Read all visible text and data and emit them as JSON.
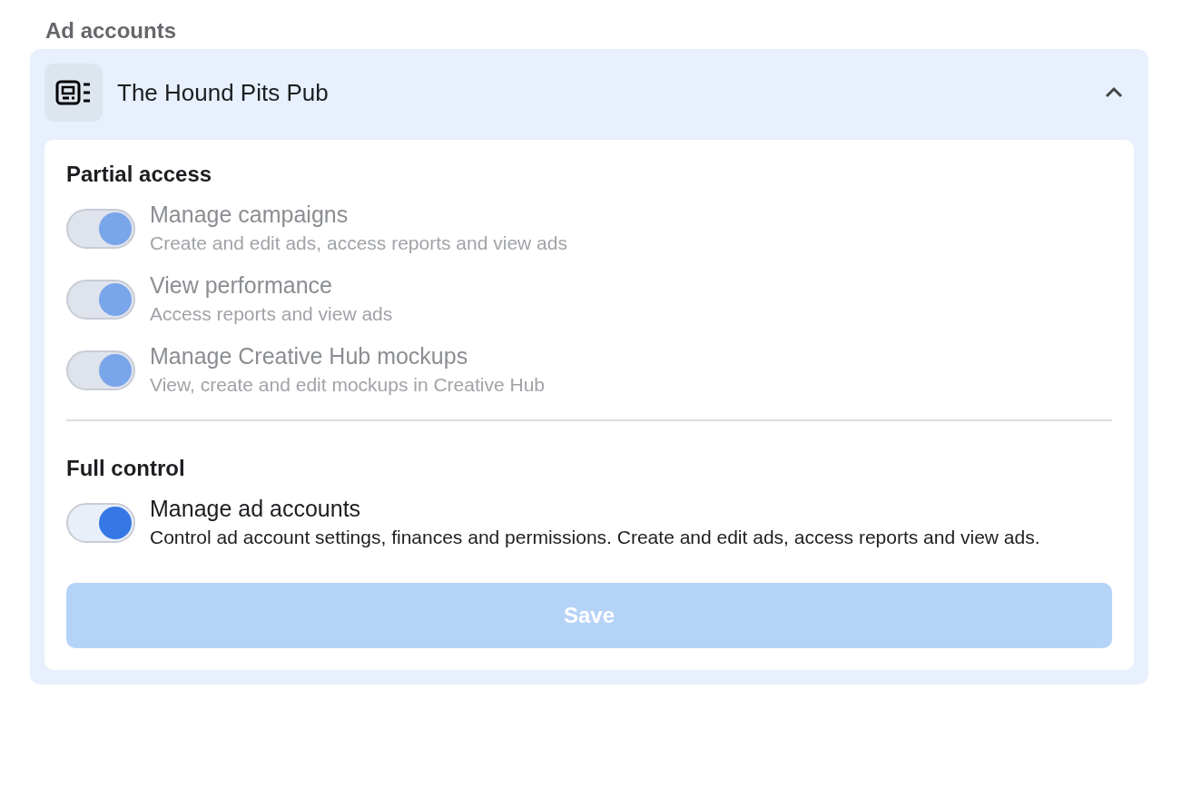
{
  "heading": "Ad accounts",
  "account": {
    "name": "The Hound Pits Pub",
    "expanded": true
  },
  "sections": [
    {
      "title": "Partial access",
      "permissions": [
        {
          "title": "Manage campaigns",
          "description": "Create and edit ads, access reports and view ads",
          "on": true,
          "disabled": true
        },
        {
          "title": "View performance",
          "description": "Access reports and view ads",
          "on": true,
          "disabled": true
        },
        {
          "title": "Manage Creative Hub mockups",
          "description": "View, create and edit mockups in Creative Hub",
          "on": true,
          "disabled": true
        }
      ]
    },
    {
      "title": "Full control",
      "permissions": [
        {
          "title": "Manage ad accounts",
          "description": "Control ad account settings, finances and permissions. Create and edit ads, access reports and view ads.",
          "on": true,
          "disabled": false
        }
      ]
    }
  ],
  "save_button": {
    "label": "Save",
    "disabled": true
  }
}
